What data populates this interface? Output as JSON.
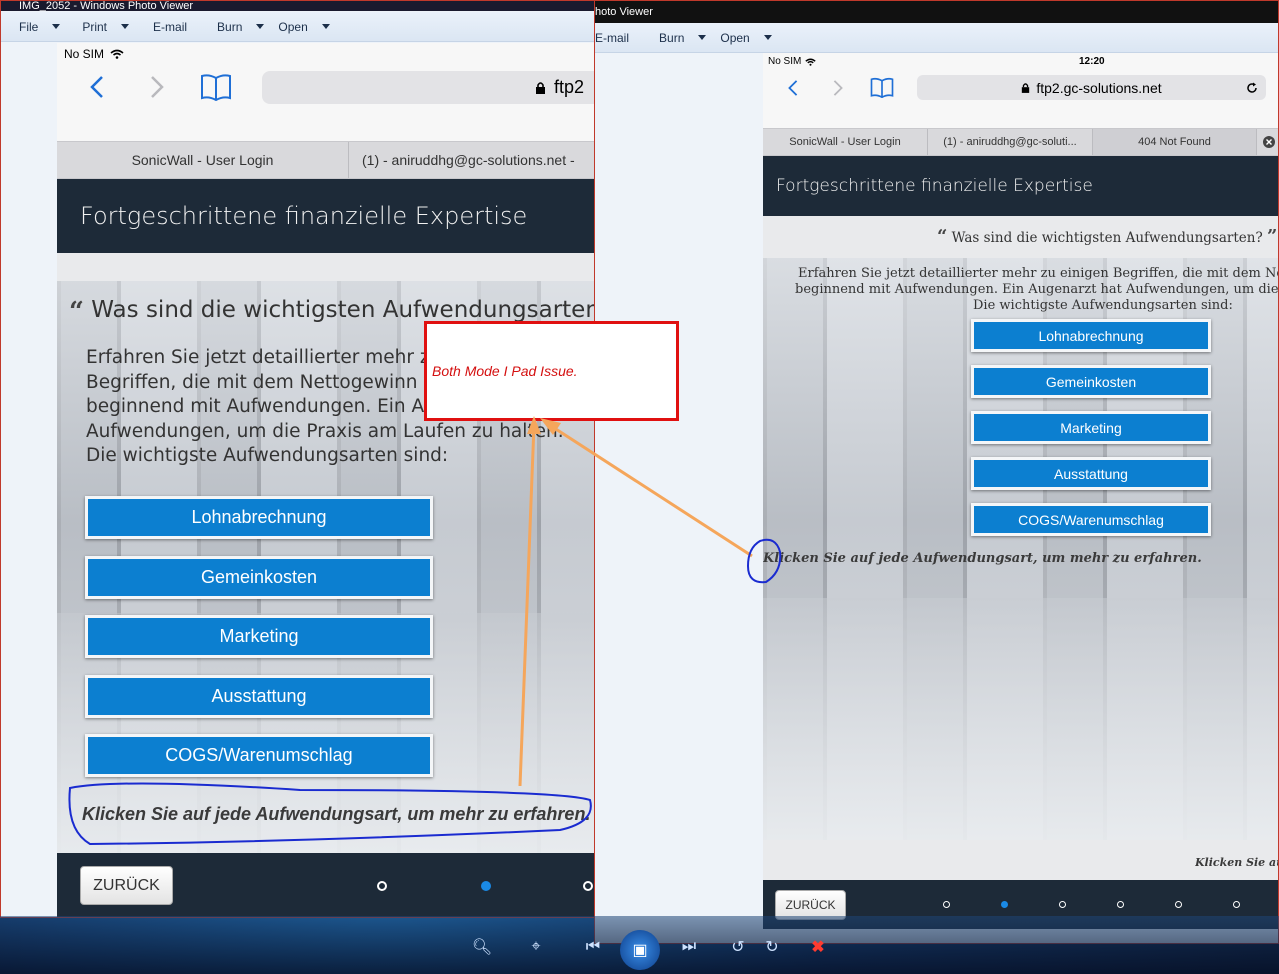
{
  "left_window": {
    "title": "IMG_2052 - Windows Photo Viewer",
    "menu": [
      "File",
      "Print",
      "E-mail",
      "Burn",
      "Open"
    ],
    "ios": {
      "carrier": "No SIM",
      "url_partial": "ftp2",
      "tabs": [
        "SonicWall - User Login",
        "(1) - aniruddhg@gc-solutions.net -"
      ],
      "header_title": "Fortgeschrittene finanzielle Expertise",
      "question": "Was sind die wichtigsten Aufwendungsarten?",
      "body_lines": [
        "Erfahren Sie jetzt detaillierter mehr zu",
        "Begriffen, die mit dem Nettogewinn ve",
        "beginnend mit Aufwendungen. Ein Aus",
        "Aufwendungen, um die Praxis am Laufen zu halten.",
        "Die wichtigste Aufwendungsarten sind:"
      ],
      "buttons": [
        "Lohnabrechnung",
        "Gemeinkosten",
        "Marketing",
        "Ausstattung",
        "COGS/Warenumschlag"
      ],
      "hint": "Klicken Sie auf jede Aufwendungsart, um mehr zu erfahren.",
      "back_label": "ZURÜCK",
      "page_dots": 3,
      "active_dot": 2
    }
  },
  "right_window": {
    "title": "hoto Viewer",
    "menu": [
      "E-mail",
      "Burn",
      "Open"
    ],
    "ios": {
      "carrier": "No SIM",
      "time": "12:20",
      "url": "ftp2.gc-solutions.net",
      "tabs": [
        "SonicWall - User Login",
        "(1) - aniruddhg@gc-soluti...",
        "404 Not Found"
      ],
      "header_title": "Fortgeschrittene finanzielle Expertise",
      "question": "Was sind die wichtigsten Aufwendungsarten?",
      "body_lines": [
        "Erfahren Sie jetzt detaillierter mehr zu einigen Begriffen, die mit dem Nettogewin",
        "beginnend mit Aufwendungen. Ein Augenarzt hat Aufwendungen, um die Praxis ar",
        "Die wichtigste Aufwendungsarten sind:"
      ],
      "buttons": [
        "Lohnabrechnung",
        "Gemeinkosten",
        "Marketing",
        "Ausstattung",
        "COGS/Warenumschlag"
      ],
      "hint": "Klicken Sie auf jede Aufwendungsart, um mehr zu erfahren.",
      "hint_bottom": "Klicken Sie auf \"W",
      "back_label": "ZURÜCK",
      "page_dots": 6,
      "active_dot": 2
    }
  },
  "annotation": {
    "callout_text": "Both Mode I Pad Issue.",
    "arrow_color": "#f5a65b",
    "callout_border": "#e01010",
    "circle_color": "#1a2bd0"
  },
  "colors": {
    "button_blue": "#0c7fd0",
    "header_dark": "#1d2a38",
    "link_blue": "#1f6fd6"
  }
}
